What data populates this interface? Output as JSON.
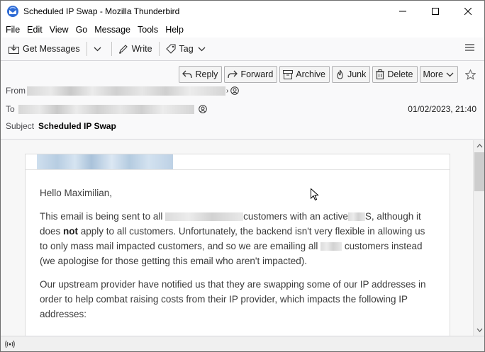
{
  "window": {
    "title": "Scheduled IP Swap - Mozilla Thunderbird"
  },
  "menu": [
    "File",
    "Edit",
    "View",
    "Go",
    "Message",
    "Tools",
    "Help"
  ],
  "toolbar": {
    "get_messages": "Get Messages",
    "write": "Write",
    "tag": "Tag"
  },
  "actions": {
    "reply": "Reply",
    "forward": "Forward",
    "archive": "Archive",
    "junk": "Junk",
    "delete": "Delete",
    "more": "More"
  },
  "header": {
    "from_label": "From",
    "to_label": "To",
    "subject_label": "Subject",
    "subject": "Scheduled IP Swap",
    "date": "01/02/2023, 21:40"
  },
  "message": {
    "greeting": "Hello Maximilian,",
    "p1_a": "This email is being sent to all ",
    "p1_b": "customers with an active",
    "p1_c": "S, although it does ",
    "p1_not": "not",
    "p1_d": " apply to all customers. Unfortunately, the backend isn't very flexible in allowing us to only mass mail impacted customers, and so we are emailing all ",
    "p1_e": " customers instead (we apologise for those getting this email who aren't impacted).",
    "p2": "Our upstream provider have notified us that they are swapping some of our IP addresses in order to help combat raising costs from their IP provider, which impacts the following IP addresses:"
  },
  "colors": {
    "accent": "#0a84ff",
    "logo_blue": "#2e6bd4"
  },
  "icons": [
    "thunderbird-logo-icon",
    "minimize-icon",
    "maximize-icon",
    "close-icon",
    "get-messages-icon",
    "chevron-down-icon",
    "pencil-icon",
    "tag-icon",
    "hamburger-menu-icon",
    "reply-icon",
    "forward-icon",
    "archive-icon",
    "junk-icon",
    "trash-icon",
    "star-icon",
    "contact-icon",
    "activity-icon"
  ]
}
